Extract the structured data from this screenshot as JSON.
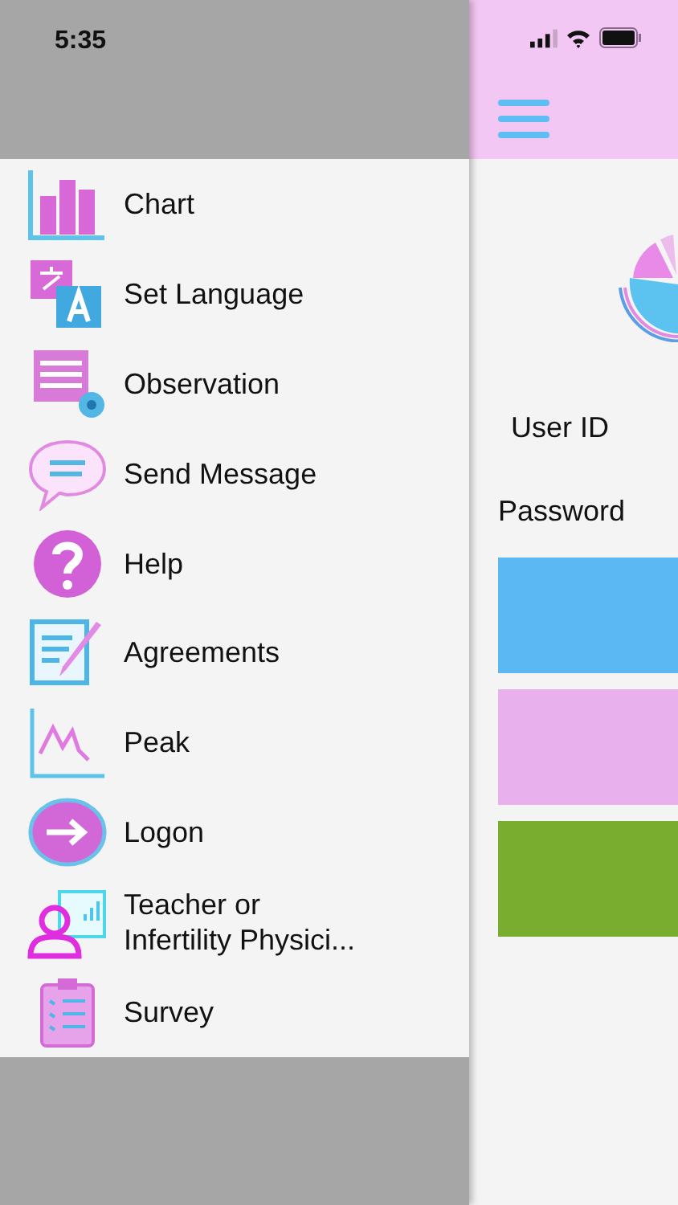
{
  "status_bar": {
    "time": "5:35"
  },
  "menu": {
    "items": [
      {
        "label": "Chart"
      },
      {
        "label": "Set Language"
      },
      {
        "label": "Observation"
      },
      {
        "label": "Send Message"
      },
      {
        "label": "Help"
      },
      {
        "label": "Agreements"
      },
      {
        "label": "Peak"
      },
      {
        "label": "Logon"
      },
      {
        "label": "Teacher or\nInfertility Physici..."
      },
      {
        "label": "Survey"
      }
    ]
  },
  "login": {
    "fields": [
      {
        "label": "User ID"
      },
      {
        "label": "Password"
      }
    ],
    "buttons": [
      {
        "color": "#5bb8f2"
      },
      {
        "color": "#e9b0ee"
      },
      {
        "color": "#79ad2f"
      }
    ]
  }
}
